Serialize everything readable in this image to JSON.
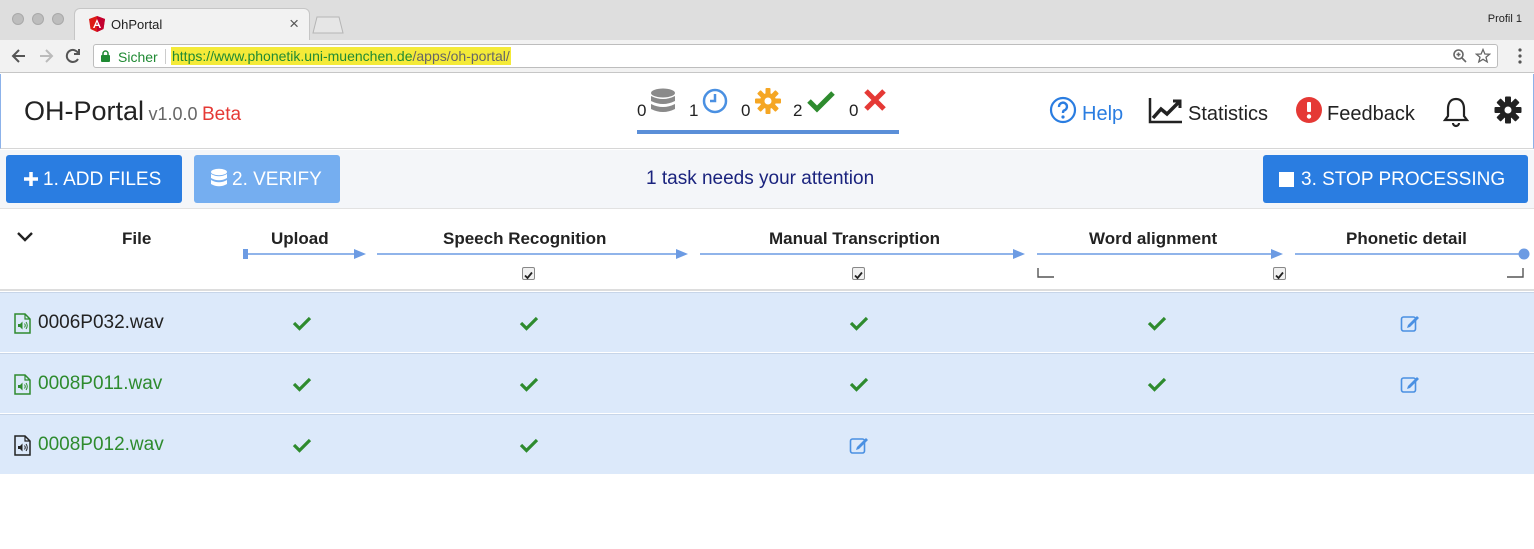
{
  "browser": {
    "tab_title": "OhPortal",
    "profile": "Profil 1",
    "secure_label": "Sicher",
    "url_scheme": "https://",
    "url_host": "www.phonetik.uni-muenchen.de",
    "url_path": "/apps/oh-portal/"
  },
  "header": {
    "app_name": "OH-Portal",
    "version": "v1.0.0",
    "beta": "Beta",
    "counters": [
      {
        "icon": "database-icon",
        "value": "0"
      },
      {
        "icon": "clock-icon",
        "value": "1"
      },
      {
        "icon": "gear-icon",
        "value": "0"
      },
      {
        "icon": "check-icon",
        "value": "2"
      },
      {
        "icon": "x-icon",
        "value": "0"
      }
    ],
    "links": {
      "help": "Help",
      "statistics": "Statistics",
      "feedback": "Feedback"
    }
  },
  "actions": {
    "add_files": "1. ADD FILES",
    "verify": "2. VERIFY",
    "attention": "1 task needs your attention",
    "stop": "3. STOP PROCESSING"
  },
  "table": {
    "columns": [
      "File",
      "Upload",
      "Speech Recognition",
      "Manual Transcription",
      "Word alignment",
      "Phonetic detail"
    ],
    "rows": [
      {
        "file": "0006P032.wav",
        "file_color": "#222222",
        "cells": [
          "check",
          "check",
          "check",
          "check",
          "edit"
        ]
      },
      {
        "file": "0008P011.wav",
        "file_color": "#2e8b2e",
        "cells": [
          "check",
          "check",
          "check",
          "check",
          "edit"
        ]
      },
      {
        "file": "0008P012.wav",
        "file_color": "#2e8b2e",
        "cells": [
          "check",
          "check",
          "edit",
          "",
          ""
        ]
      }
    ]
  },
  "colors": {
    "primary": "#2a7de1",
    "primary_light": "#75aef0",
    "success": "#2e8b2e",
    "danger": "#e53935",
    "warning": "#f5a623",
    "info": "#4a90e2",
    "row_bg": "#dce9fa"
  }
}
